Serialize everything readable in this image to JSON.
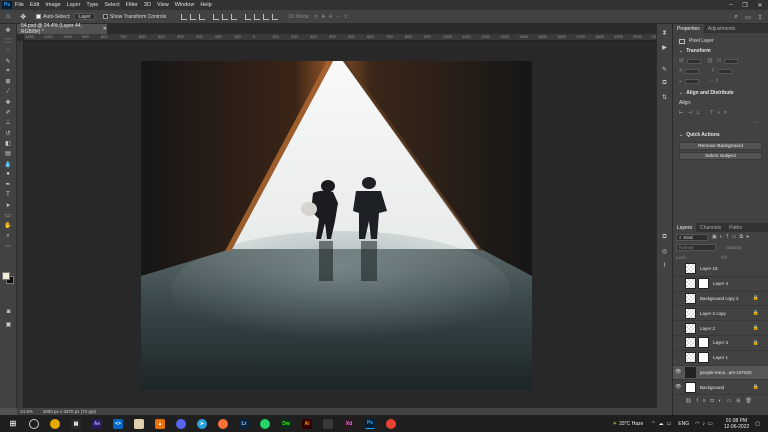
{
  "menubar": {
    "logo": "Ps",
    "items": [
      "File",
      "Edit",
      "Image",
      "Layer",
      "Type",
      "Select",
      "Filter",
      "3D",
      "View",
      "Window",
      "Help"
    ],
    "window_controls": [
      "–",
      "❐",
      "✕"
    ]
  },
  "options": {
    "auto_select_label": "Auto-Select:",
    "auto_select_value": "Layer",
    "transform_label": "Show Transform Controls",
    "mode_3d": "3D Mode:"
  },
  "document": {
    "tab_title": "54.psd @ 24.4% (Layer 44, RGB/8#) *",
    "ruler_ticks": [
      "1200",
      "1100",
      "1000",
      "900",
      "800",
      "700",
      "600",
      "500",
      "400",
      "300",
      "200",
      "100",
      "0",
      "100",
      "200",
      "300",
      "400",
      "500",
      "600",
      "700",
      "800",
      "900",
      "1000",
      "1100",
      "1200",
      "1300",
      "1400",
      "1500",
      "1600",
      "1700",
      "1800",
      "1900",
      "2000",
      "2100",
      "2200",
      "2300",
      "2400",
      "2500",
      "2600",
      "2700",
      "2800",
      "2900",
      "3000",
      "3100",
      "3200",
      "3300",
      "3400",
      "3500",
      "3600",
      "3700",
      "3800",
      "3900",
      "4000",
      "4100",
      "4200",
      "4300",
      "4400",
      "4500"
    ],
    "zoom": "24.4%",
    "doc_size": "4000 px x 3370 px (72 ppi)"
  },
  "properties": {
    "tabs": [
      "Properties",
      "Adjustments"
    ],
    "layer_kind": "Pixel Layer",
    "transform_title": "Transform",
    "align_title": "Align and Distribute",
    "align_label": "Align:",
    "quick_actions_title": "Quick Actions",
    "remove_bg_label": "Remove Background",
    "select_subject_label": "Select Subject"
  },
  "layers": {
    "tabs": [
      "Layers",
      "Channels",
      "Paths"
    ],
    "kind_label": "Kind",
    "blend_mode": "Normal",
    "opacity_label": "Opacity:",
    "lock_label": "Lock:",
    "fill_label": "Fill:",
    "items": [
      {
        "name": "Layer 16",
        "thumb": "checker",
        "visible": false,
        "mask": false,
        "locked": false
      },
      {
        "name": "Layer 4",
        "thumb": "checker",
        "visible": false,
        "mask": true,
        "locked": false
      },
      {
        "name": "Background copy 2",
        "thumb": "checker",
        "visible": false,
        "mask": false,
        "locked": true
      },
      {
        "name": "Layer 2 copy",
        "thumb": "checker",
        "visible": false,
        "mask": false,
        "locked": true
      },
      {
        "name": "Layer 2",
        "thumb": "checker",
        "visible": false,
        "mask": false,
        "locked": true
      },
      {
        "name": "Layer 3",
        "thumb": "checker",
        "visible": false,
        "mask": true,
        "locked": true
      },
      {
        "name": "Layer 1",
        "thumb": "checker",
        "visible": false,
        "mask": true,
        "locked": false
      },
      {
        "name": "people-trans...am-107620",
        "thumb": "dark",
        "visible": true,
        "mask": false,
        "locked": false,
        "selected": true
      },
      {
        "name": "Background",
        "thumb": "white",
        "visible": true,
        "mask": false,
        "locked": true
      }
    ]
  },
  "taskbar": {
    "weather": "33°C  Haze",
    "lang": "ENG",
    "time": "01:08 PM",
    "date": "12-06-2022"
  },
  "colors": {
    "foreground": "#f0ecd8",
    "background": "#111111",
    "accent": "#31a8ff"
  }
}
